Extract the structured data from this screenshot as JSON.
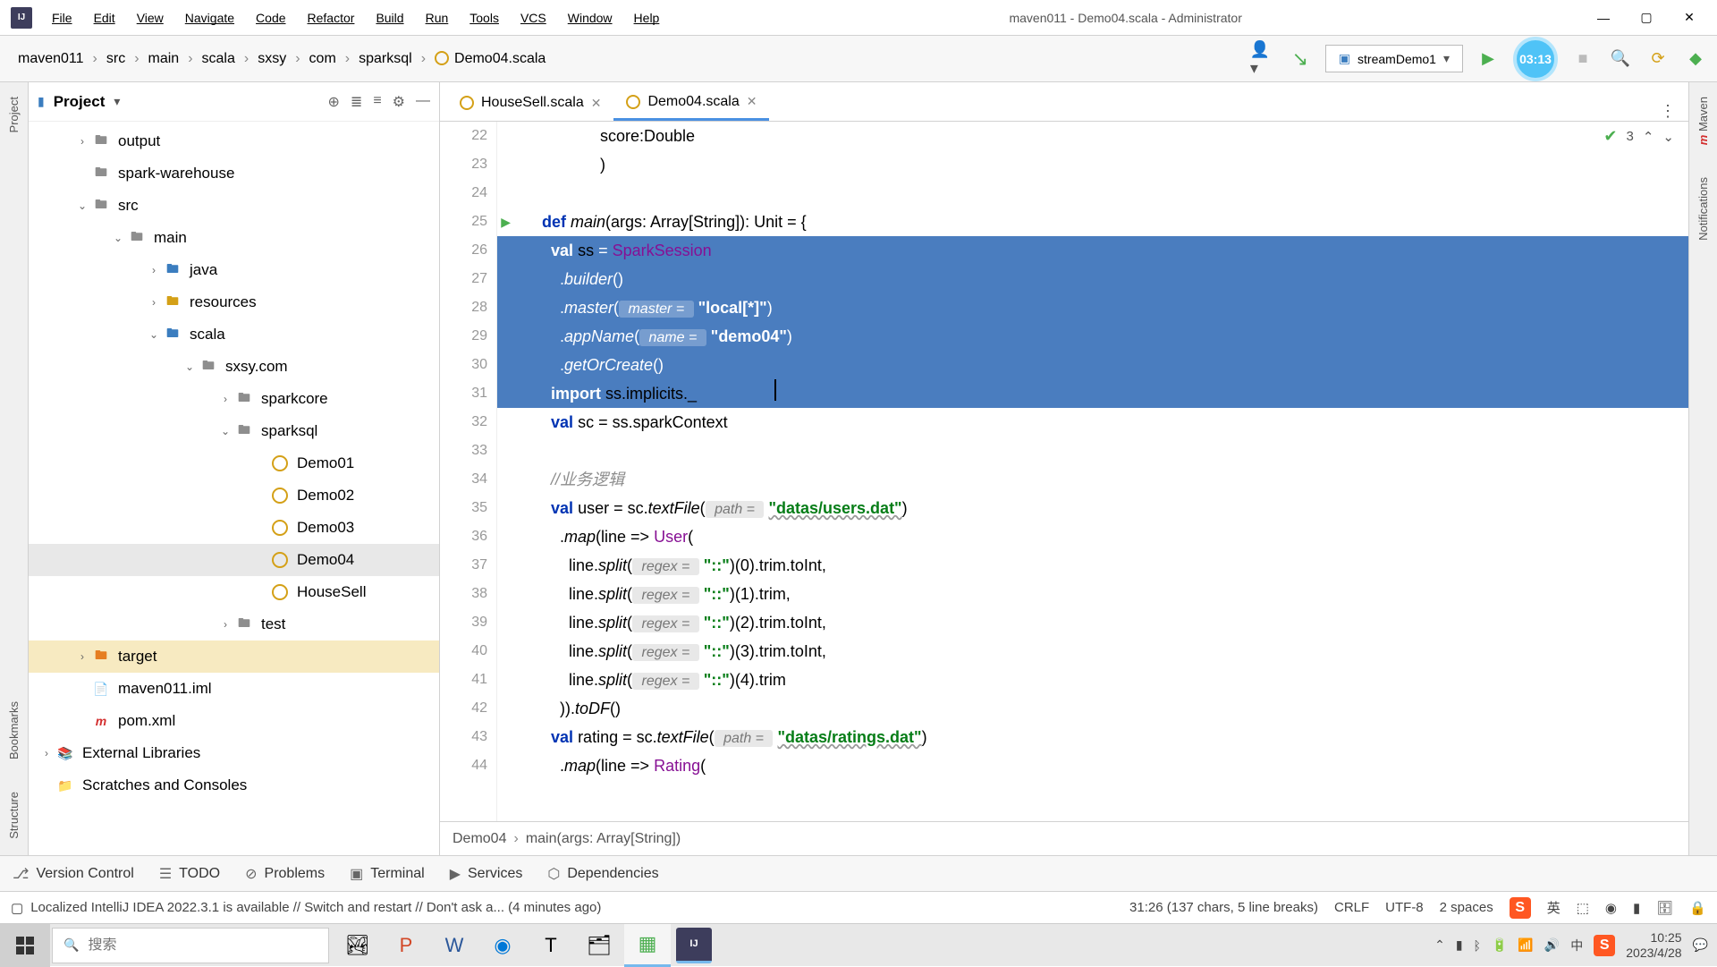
{
  "window": {
    "title": "maven011 - Demo04.scala - Administrator"
  },
  "menu": [
    "File",
    "Edit",
    "View",
    "Navigate",
    "Code",
    "Refactor",
    "Build",
    "Run",
    "Tools",
    "VCS",
    "Window",
    "Help"
  ],
  "breadcrumb": [
    "maven011",
    "src",
    "main",
    "scala",
    "sxsy",
    "com",
    "sparksql",
    "Demo04.scala"
  ],
  "run_config": "streamDemo1",
  "timer": "03:13",
  "left_stripe": [
    "Project",
    "Bookmarks",
    "Structure"
  ],
  "right_stripe": [
    "Maven",
    "Notifications"
  ],
  "project_panel_title": "Project",
  "tree": {
    "output": "output",
    "spark_warehouse": "spark-warehouse",
    "src": "src",
    "main": "main",
    "java": "java",
    "resources": "resources",
    "scala": "scala",
    "sxsy_com": "sxsy.com",
    "sparkcore": "sparkcore",
    "sparksql": "sparksql",
    "demo01": "Demo01",
    "demo02": "Demo02",
    "demo03": "Demo03",
    "demo04": "Demo04",
    "housesell": "HouseSell",
    "test": "test",
    "target": "target",
    "iml": "maven011.iml",
    "pom": "pom.xml",
    "ext_lib": "External Libraries",
    "scratches": "Scratches and Consoles"
  },
  "tabs": [
    {
      "label": "HouseSell.scala",
      "active": false
    },
    {
      "label": "Demo04.scala",
      "active": true
    }
  ],
  "editor_problems": "3",
  "code_lines": [
    {
      "n": 22,
      "html": "             score:Double"
    },
    {
      "n": 23,
      "html": "             )"
    },
    {
      "n": 24,
      "html": ""
    },
    {
      "n": 25,
      "html": "<span class='kw'>def</span> <span class='fn'>main</span>(args: Array[String]): Unit = {",
      "play": true
    },
    {
      "n": 26,
      "html": "  <span class='kw'>val</span> <span class='ident'>ss</span> = <span class='purple'>SparkSession</span>",
      "sel": true
    },
    {
      "n": 27,
      "html": "    .<span class='fn'>builder</span>()",
      "sel": true
    },
    {
      "n": 28,
      "html": "    .<span class='fn'>master</span>(<span class='hint'> master = </span> <span class='str'>\"local[*]\"</span>)",
      "sel": true
    },
    {
      "n": 29,
      "html": "    .<span class='fn'>appName</span>(<span class='hint'> name = </span> <span class='str'>\"demo04\"</span>)",
      "sel": true
    },
    {
      "n": 30,
      "html": "    .<span class='fn'>getOrCreate</span>()",
      "sel": true
    },
    {
      "n": 31,
      "html": "  <span class='kw'>import</span> <span class='ident'>ss.implicits._</span>",
      "sel": true,
      "caret": true,
      "caretCol": 260
    },
    {
      "n": 32,
      "html": "  <span class='kw'>val</span> <span class='ident'>sc</span> = ss.sparkContext"
    },
    {
      "n": 33,
      "html": ""
    },
    {
      "n": 34,
      "html": "  <span class='cmt'>//业务逻辑</span>"
    },
    {
      "n": 35,
      "html": "  <span class='kw'>val</span> <span class='ident'>user</span> = sc.<span class='fn'>textFile</span>(<span class='hint'> path = </span> <span class='str-u'>\"datas/users.dat\"</span>)"
    },
    {
      "n": 36,
      "html": "    .<span class='fn'>map</span>(line => <span class='purple'>User</span>("
    },
    {
      "n": 37,
      "html": "      line.<span class='fn'>split</span>(<span class='hint'> regex = </span> <span class='str'>\"::\"</span>)(0).trim.toInt,"
    },
    {
      "n": 38,
      "html": "      line.<span class='fn'>split</span>(<span class='hint'> regex = </span> <span class='str'>\"::\"</span>)(1).trim,"
    },
    {
      "n": 39,
      "html": "      line.<span class='fn'>split</span>(<span class='hint'> regex = </span> <span class='str'>\"::\"</span>)(2).trim.toInt,"
    },
    {
      "n": 40,
      "html": "      line.<span class='fn'>split</span>(<span class='hint'> regex = </span> <span class='str'>\"::\"</span>)(3).trim.toInt,"
    },
    {
      "n": 41,
      "html": "      line.<span class='fn'>split</span>(<span class='hint'> regex = </span> <span class='str'>\"::\"</span>)(4).trim"
    },
    {
      "n": 42,
      "html": "    )).<span class='fn'>toDF</span>()"
    },
    {
      "n": 43,
      "html": "  <span class='kw'>val</span> <span class='ident'>rating</span> = sc.<span class='fn'>textFile</span>(<span class='hint'> path = </span> <span class='str-u'>\"datas/ratings.dat\"</span>)"
    },
    {
      "n": 44,
      "html": "    .<span class='fn'>map</span>(line => <span class='purple'>Rating</span>("
    }
  ],
  "crumb_bar": [
    "Demo04",
    "main(args: Array[String])"
  ],
  "tool_bar": [
    "Version Control",
    "TODO",
    "Problems",
    "Terminal",
    "Services",
    "Dependencies"
  ],
  "status": {
    "msg": "Localized IntelliJ IDEA 2022.3.1 is available // Switch and restart // Don't ask a... (4 minutes ago)",
    "pos": "31:26 (137 chars, 5 line breaks)",
    "eol": "CRLF",
    "enc": "UTF-8",
    "indent": "2 spaces"
  },
  "taskbar": {
    "search_placeholder": "搜索",
    "ime": "英",
    "lang": "中",
    "time": "10:25",
    "date": "2023/4/28"
  }
}
